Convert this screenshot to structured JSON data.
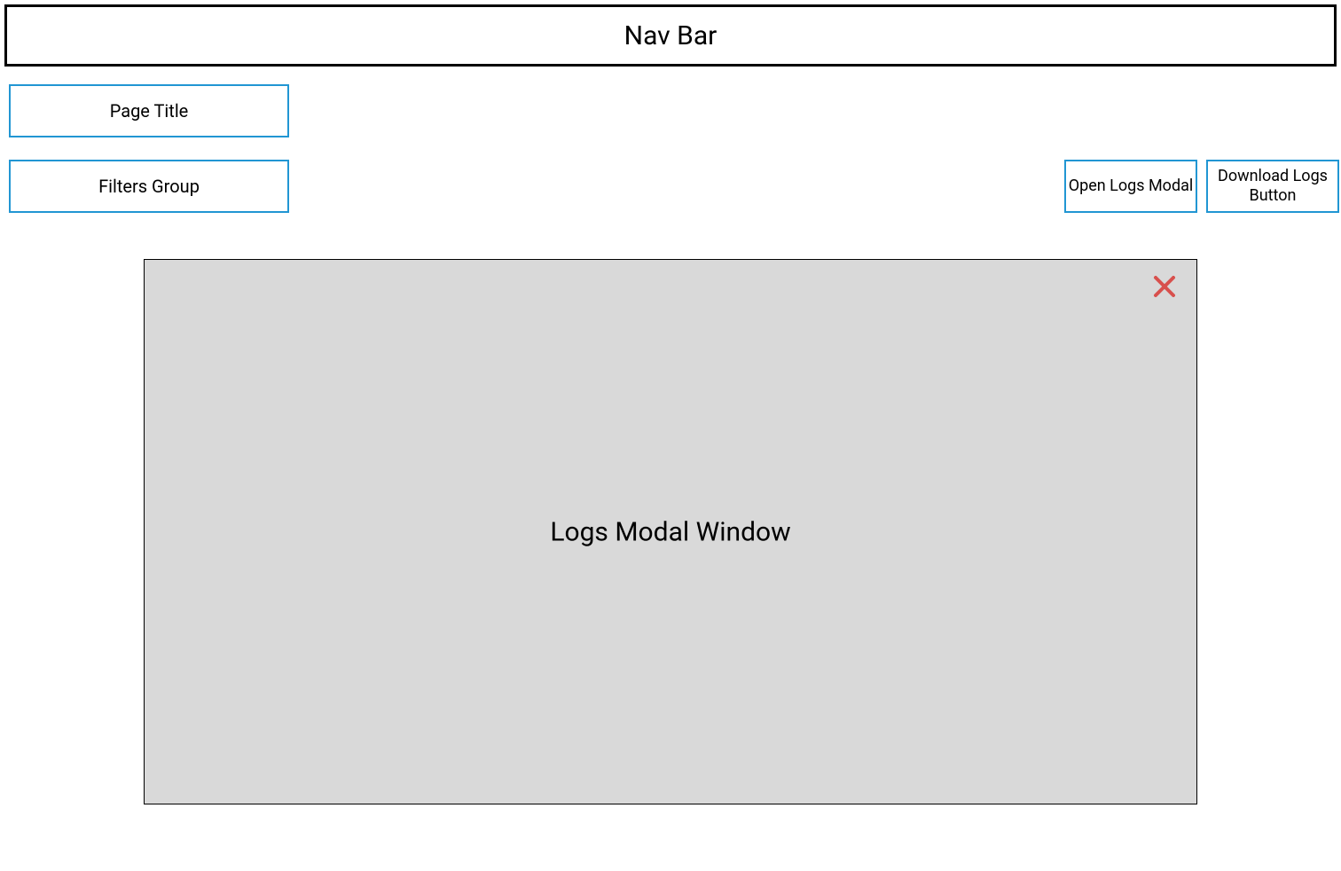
{
  "nav": {
    "title": "Nav Bar"
  },
  "page": {
    "title_label": "Page Title",
    "filters_label": "Filters Group"
  },
  "buttons": {
    "open_logs": "Open Logs Modal",
    "download_logs": "Download Logs Button"
  },
  "modal": {
    "title": "Logs Modal Window"
  },
  "colors": {
    "accent": "#2196d3",
    "modal_bg": "#d9d9d9",
    "close_icon": "#d8504d"
  }
}
